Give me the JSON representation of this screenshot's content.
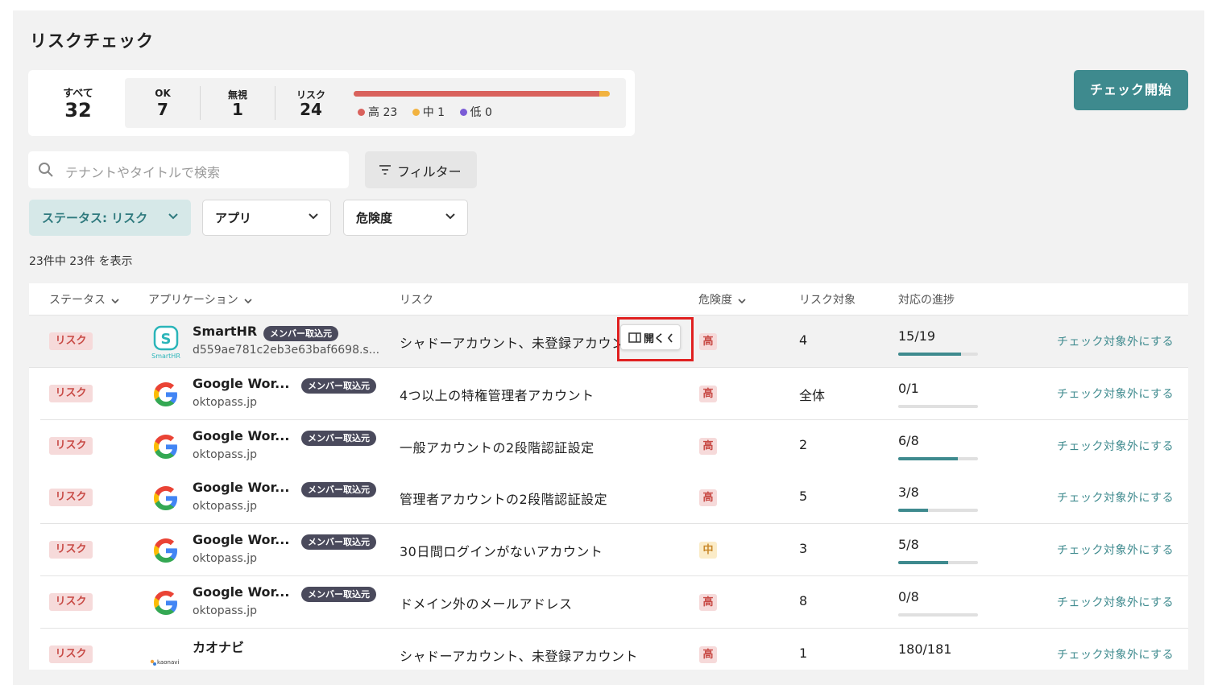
{
  "page": {
    "title": "リスクチェック"
  },
  "summary": {
    "all": {
      "label": "すべて",
      "value": "32"
    },
    "ok": {
      "label": "OK",
      "value": "7"
    },
    "ignored": {
      "label": "無視",
      "value": "1"
    },
    "risk": {
      "label": "リスク",
      "value": "24"
    },
    "risk_levels": [
      {
        "label": "高 23",
        "count": 23,
        "color": "#d9625d"
      },
      {
        "label": "中 1",
        "count": 1,
        "color": "#f2b340"
      },
      {
        "label": "低 0",
        "count": 0,
        "color": "#7a5cd6"
      }
    ]
  },
  "actions": {
    "start_check": "チェック開始"
  },
  "search": {
    "placeholder": "テナントやタイトルで検索"
  },
  "filter": {
    "label": "フィルター"
  },
  "dropdowns": {
    "status": "ステータス: リスク",
    "app": "アプリ",
    "severity": "危険度"
  },
  "result_count": "23件中 23件 を表示",
  "table": {
    "headers": {
      "status": "ステータス",
      "application": "アプリケーション",
      "risk": "リスク",
      "severity": "危険度",
      "target": "リスク対象",
      "progress": "対応の進捗"
    },
    "open_button": "開く",
    "rows": [
      {
        "status": "リスク",
        "app": "SmartHR",
        "badge": "メンバー取込元",
        "tenant": "d559ae781c2eb3e63baf6698.s...",
        "risk": "シャドーアカウント、未登録アカウント",
        "severity": "高",
        "target": "4",
        "progress": "15/19",
        "progress_ratio": 0.79,
        "exclude": "チェック対象外にする"
      },
      {
        "status": "リスク",
        "app": "Google Wor...",
        "badge": "メンバー取込元",
        "tenant": "oktopass.jp",
        "risk": "4つ以上の特権管理者アカウント",
        "severity": "高",
        "target": "全体",
        "progress": "0/1",
        "progress_ratio": 0,
        "exclude": "チェック対象外にする"
      },
      {
        "status": "リスク",
        "app": "Google Wor...",
        "badge": "メンバー取込元",
        "tenant": "oktopass.jp",
        "risk": "一般アカウントの2段階認証設定",
        "severity": "高",
        "target": "2",
        "progress": "6/8",
        "progress_ratio": 0.75,
        "exclude": "チェック対象外にする"
      },
      {
        "status": "リスク",
        "app": "Google Wor...",
        "badge": "メンバー取込元",
        "tenant": "oktopass.jp",
        "risk": "管理者アカウントの2段階認証設定",
        "severity": "高",
        "target": "5",
        "progress": "3/8",
        "progress_ratio": 0.375,
        "exclude": "チェック対象外にする"
      },
      {
        "status": "リスク",
        "app": "Google Wor...",
        "badge": "メンバー取込元",
        "tenant": "oktopass.jp",
        "risk": "30日間ログインがないアカウント",
        "severity": "中",
        "target": "3",
        "progress": "5/8",
        "progress_ratio": 0.625,
        "exclude": "チェック対象外にする"
      },
      {
        "status": "リスク",
        "app": "Google Wor...",
        "badge": "メンバー取込元",
        "tenant": "oktopass.jp",
        "risk": "ドメイン外のメールアドレス",
        "severity": "高",
        "target": "8",
        "progress": "0/8",
        "progress_ratio": 0,
        "exclude": "チェック対象外にする"
      },
      {
        "status": "リスク",
        "app": "カオナビ",
        "badge": "",
        "tenant": "",
        "risk": "シャドーアカウント、未登録アカウント",
        "severity": "高",
        "target": "1",
        "progress": "180/181",
        "progress_ratio": 0.99,
        "exclude": "チェック対象外にする"
      }
    ]
  },
  "logos": {
    "smarthr_caption": "SmartHR",
    "kaonavi_caption": "kaonavi"
  },
  "colors": {
    "accent": "#3e8a8e",
    "risk_red": "#c84a45",
    "mid_orange": "#c9892c"
  }
}
